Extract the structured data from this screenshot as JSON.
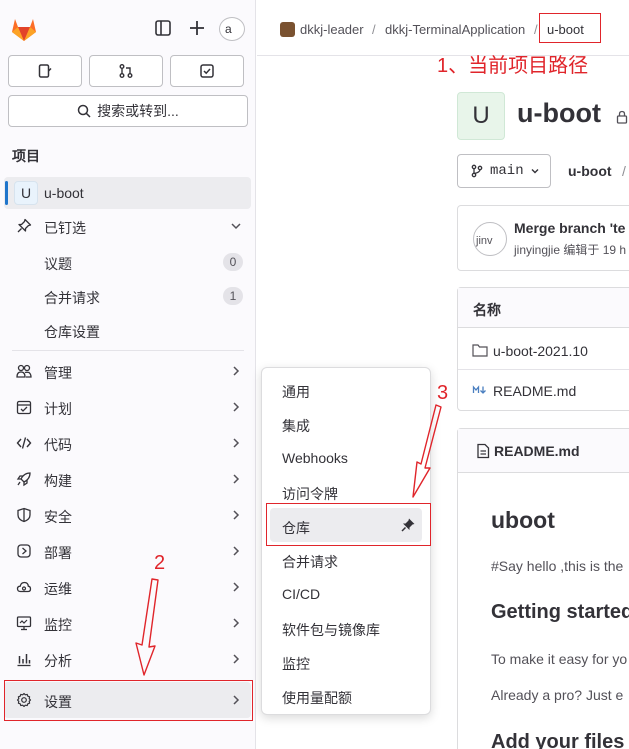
{
  "sidebar": {
    "brand": "gitlab-logo",
    "avatar_text": "a",
    "search_label": "搜索或转到...",
    "section_title": "项目",
    "project": {
      "initial": "U",
      "name": "u-boot"
    },
    "pinned": {
      "label": "已钉选",
      "items": [
        {
          "label": "议题",
          "count": "0"
        },
        {
          "label": "合并请求",
          "count": "1"
        },
        {
          "label": "仓库设置",
          "count": ""
        }
      ]
    },
    "nav": [
      {
        "label": "管理",
        "icon": "users-icon"
      },
      {
        "label": "计划",
        "icon": "calendar-icon"
      },
      {
        "label": "代码",
        "icon": "code-icon"
      },
      {
        "label": "构建",
        "icon": "rocket-icon"
      },
      {
        "label": "安全",
        "icon": "shield-icon"
      },
      {
        "label": "部署",
        "icon": "deploy-icon"
      },
      {
        "label": "运维",
        "icon": "cloud-icon"
      },
      {
        "label": "监控",
        "icon": "monitor-icon"
      },
      {
        "label": "分析",
        "icon": "chart-icon"
      }
    ],
    "settings_label": "设置"
  },
  "breadcrumb": {
    "group": "dkkj-leader",
    "subgroup": "dkkj-TerminalApplication",
    "current": "u-boot",
    "separator": "/"
  },
  "project_header": {
    "initial": "U",
    "title": "u-boot"
  },
  "repo": {
    "branch": "main",
    "path": "u-boot",
    "path_sep": "/",
    "commit_title": "Merge branch 'te",
    "commit_meta": "jinyingjie 编辑于 19 h",
    "commit_avatar_text": "jinv",
    "table_header": "名称",
    "files": [
      {
        "name": "u-boot-2021.10",
        "icon": "folder-icon"
      },
      {
        "name": "README.md",
        "icon": "markdown-icon"
      }
    ]
  },
  "readme": {
    "file": "README.md",
    "h1": "uboot",
    "p1": "#Say hello ,this is the",
    "h2": "Getting started",
    "p2": "To make it easy for yo",
    "p3": "Already a pro? Just e",
    "h3": "Add your files"
  },
  "settings_menu": {
    "items": [
      "通用",
      "集成",
      "Webhooks",
      "访问令牌",
      "仓库",
      "合并请求",
      "CI/CD",
      "软件包与镜像库",
      "监控",
      "使用量配额"
    ],
    "highlighted_index": 4
  },
  "annotations": {
    "a1": "1、当前项目路径",
    "a2": "2",
    "a3": "3",
    "color": "#e0252b"
  }
}
